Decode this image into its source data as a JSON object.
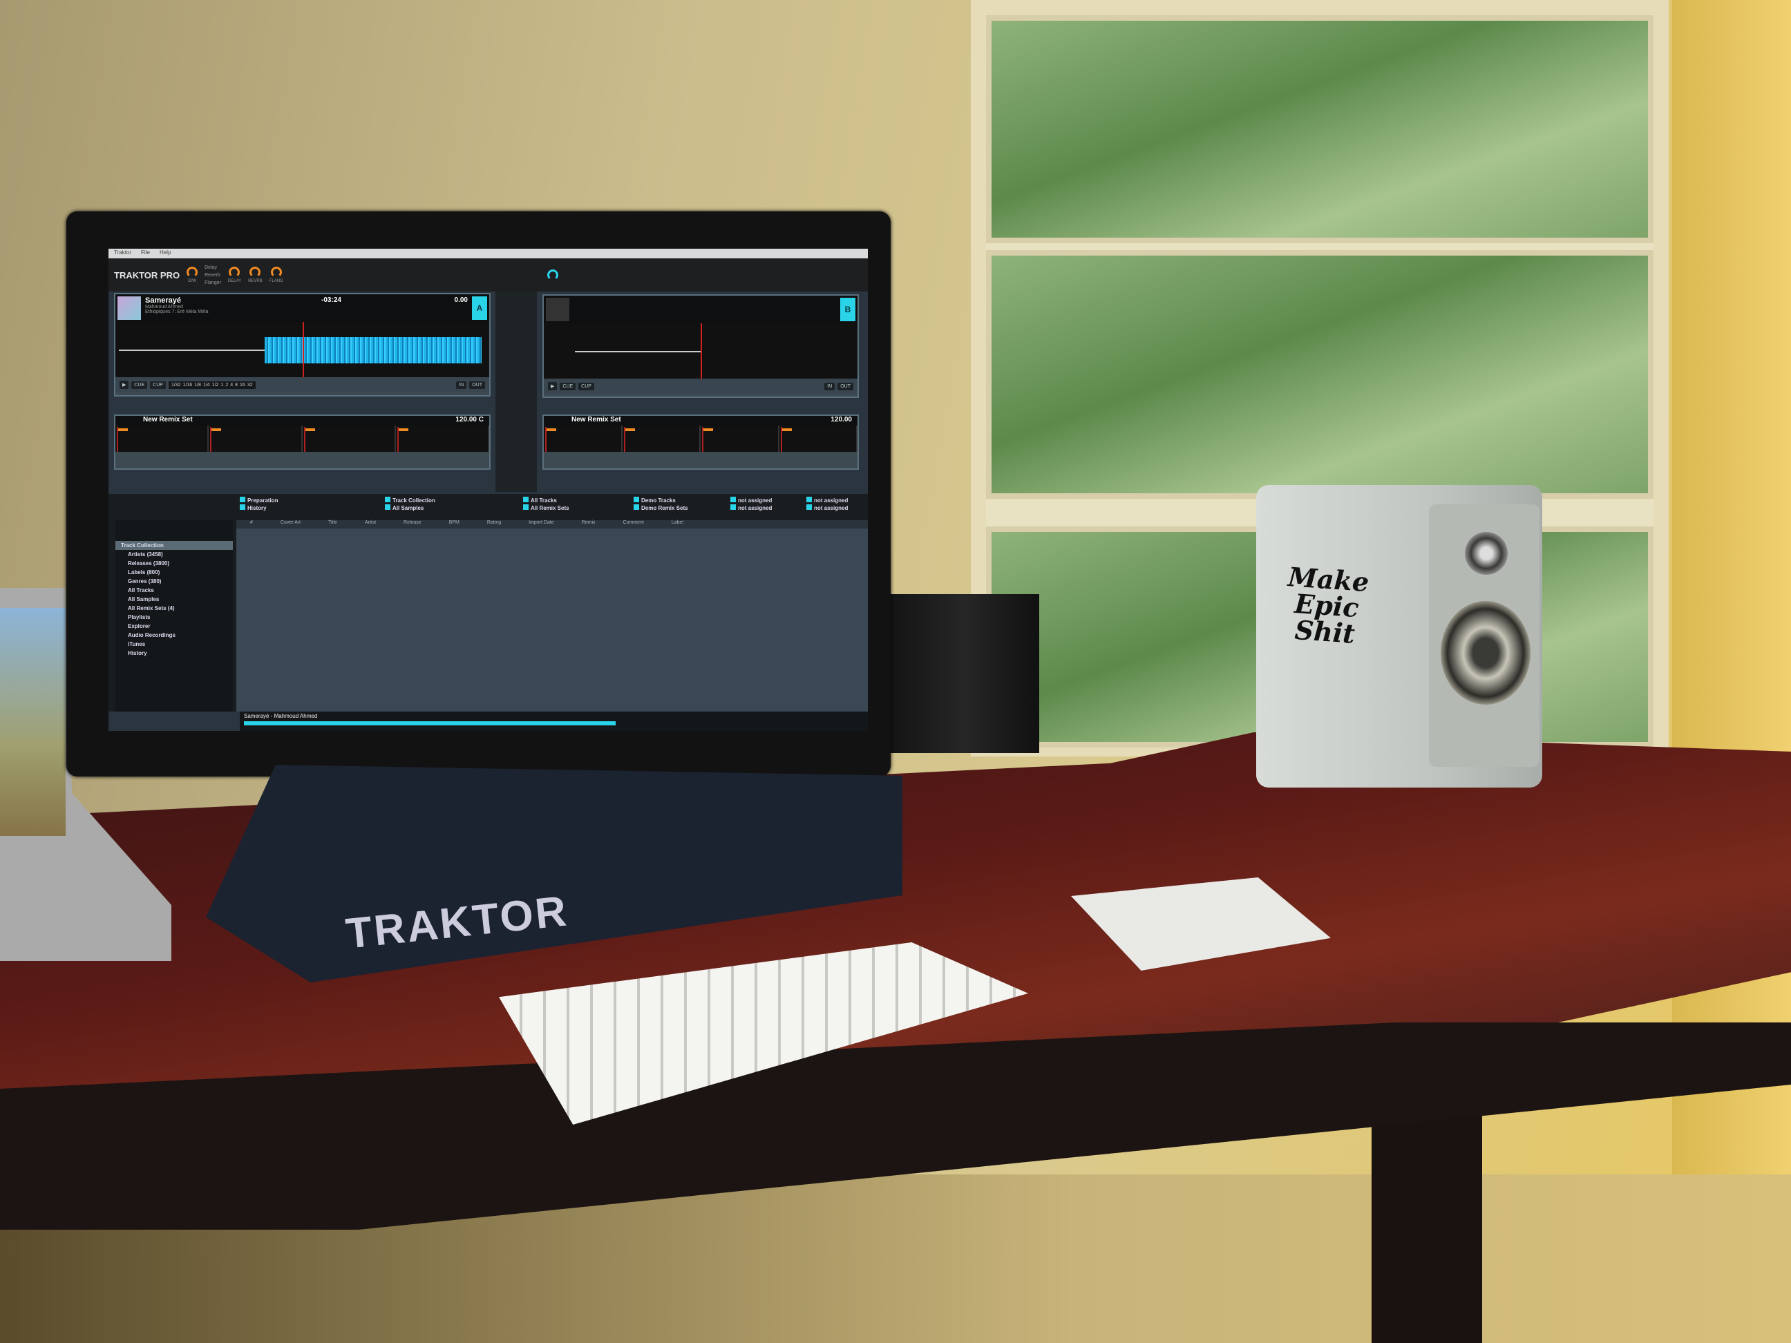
{
  "app": {
    "menu": [
      "Traktor",
      "File",
      "Help"
    ],
    "logo": "TRAKTOR PRO"
  },
  "fx": {
    "units": [
      "Delay",
      "Reverb",
      "Flanger"
    ],
    "knobs": [
      "D/W",
      "DELAY",
      "REVRB",
      "FLANG"
    ]
  },
  "deck_a": {
    "letter": "A",
    "title": "Samerayé",
    "artist": "Mahmoud Ahmed",
    "album": "Ethiopiques 7: Erè Mèla Mèla",
    "time": "-03:24",
    "tempo": "0.00",
    "buttons": {
      "play": "▶",
      "cue": "CUE",
      "cup": "CUP",
      "in": "IN",
      "out": "OUT"
    },
    "beat_sizes": [
      "1/32",
      "1/16",
      "1/8",
      "1/4",
      "1/2",
      "1",
      "2",
      "4",
      "8",
      "16",
      "32"
    ]
  },
  "deck_b": {
    "letter": "B",
    "buttons": {
      "play": "▶",
      "cue": "CUE",
      "cup": "CUP",
      "in": "IN",
      "out": "OUT"
    }
  },
  "remix_c": {
    "title": "New Remix Set",
    "bpm": "120.00",
    "key": "C"
  },
  "remix_d": {
    "title": "New Remix Set",
    "bpm": "120.00"
  },
  "browser": {
    "favorites": [
      "Preparation",
      "History",
      "Track Collection",
      "All Samples",
      "All Tracks",
      "All Remix Sets",
      "Demo Tracks",
      "Demo Remix Sets",
      "not assigned",
      "not assigned",
      "not assigned",
      "not assigned"
    ],
    "tree": [
      "Track Collection",
      "Artists (3458)",
      "Releases (3800)",
      "Labels (800)",
      "Genres (380)",
      "All Tracks",
      "All Samples",
      "All Remix Sets (4)",
      "Playlists",
      "Explorer",
      "Audio Recordings",
      "iTunes",
      "History"
    ],
    "columns": [
      "#",
      "Cover Art",
      "Title",
      "Artist",
      "Release",
      "BPM",
      "Rating",
      "Import Date",
      "Remix",
      "Comment",
      "Label"
    ]
  },
  "status": {
    "now_playing": "Samerayé - Mahmoud Ahmed",
    "progress_percent": 60
  },
  "hardware": {
    "controller_brand": "TRAKTOR",
    "sticker": "Make Epic Shit"
  }
}
